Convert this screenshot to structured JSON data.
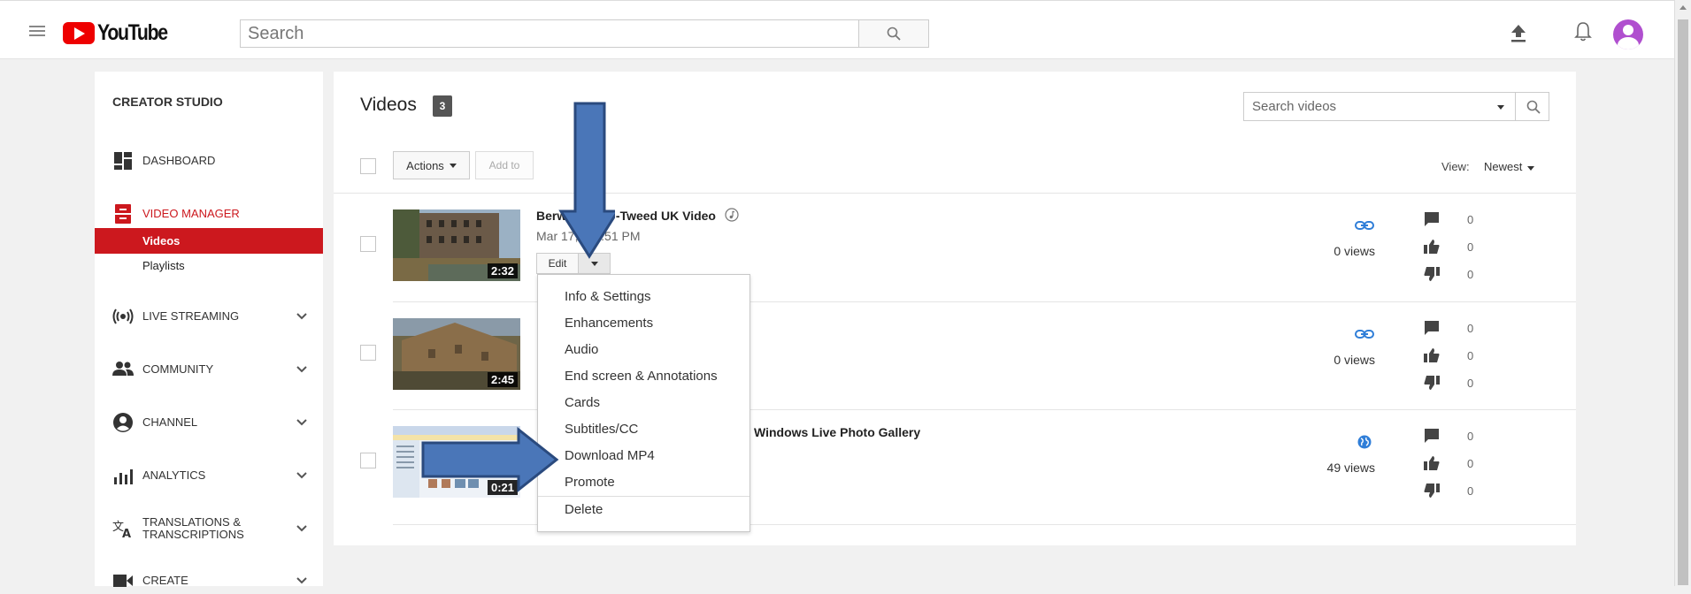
{
  "header": {
    "logo_text": "YouTube",
    "search_placeholder": "Search"
  },
  "sidebar": {
    "title": "CREATOR STUDIO",
    "items": [
      {
        "label": "DASHBOARD",
        "icon": "dashboard-icon"
      },
      {
        "label": "VIDEO MANAGER",
        "icon": "video-manager-icon"
      },
      {
        "label": "LIVE STREAMING",
        "icon": "live-streaming-icon"
      },
      {
        "label": "COMMUNITY",
        "icon": "community-icon"
      },
      {
        "label": "CHANNEL",
        "icon": "channel-icon"
      },
      {
        "label": "ANALYTICS",
        "icon": "analytics-icon"
      },
      {
        "label": "TRANSLATIONS & TRANSCRIPTIONS",
        "icon": "translations-icon"
      },
      {
        "label": "CREATE",
        "icon": "create-icon"
      }
    ],
    "subitems": [
      {
        "label": "Videos",
        "active": true
      },
      {
        "label": "Playlists",
        "active": false
      }
    ],
    "accent_color": "#cc181e"
  },
  "main": {
    "title": "Videos",
    "count": "3",
    "search_placeholder": "Search videos",
    "actions_label": "Actions",
    "addto_label": "Add to",
    "view_label": "View:",
    "view_sort": "Newest",
    "videos": [
      {
        "title": "Berwick-upon-Tweed UK Video",
        "title_visible": "Berwic",
        "title_visible_2": "-Tweed UK Video",
        "date": "Mar 17, ",
        "time": "2:51 PM",
        "duration": "2:32",
        "views": "0 views",
        "comments": "0",
        "likes": "0",
        "dislikes": "0",
        "visibility": "link-icon"
      },
      {
        "title": "",
        "date": "",
        "duration": "2:45",
        "views": "0 views",
        "comments": "0",
        "likes": "0",
        "dislikes": "0",
        "visibility": "link-icon"
      },
      {
        "title": "Windows Live Photo Gallery",
        "date": "",
        "duration": "0:21",
        "views": "49 views",
        "comments": "0",
        "likes": "0",
        "dislikes": "0",
        "visibility": "globe-icon"
      }
    ],
    "edit_label": "Edit"
  },
  "dropdown": {
    "items": [
      "Info & Settings",
      "Enhancements",
      "Audio",
      "End screen & Annotations",
      "Cards",
      "Subtitles/CC",
      "Download MP4",
      "Promote"
    ],
    "delete_label": "Delete"
  }
}
